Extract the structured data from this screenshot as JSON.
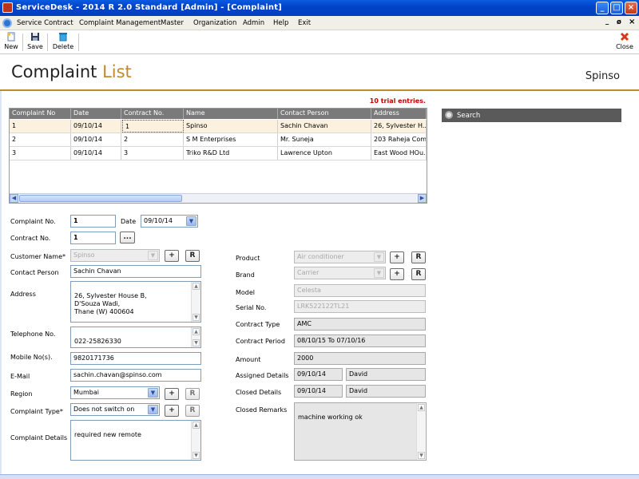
{
  "window": {
    "title": "ServiceDesk - 2014 R 2.0 Standard [Admin] - [Complaint]"
  },
  "menu": [
    "Service Contract",
    "Complaint Management",
    "Master",
    "Organization",
    "Admin",
    "Help",
    "Exit"
  ],
  "mdi_controls": {
    "minimize": "_",
    "restore": "ø",
    "close": "×"
  },
  "toolbar": {
    "new_label": "New",
    "save_label": "Save",
    "delete_label": "Delete",
    "close_label": "Close"
  },
  "header": {
    "title_main": "Complaint",
    "title_sub": "List",
    "org": "Spinso"
  },
  "trial_text": "10 trial entries.",
  "grid": {
    "columns": [
      "Complaint No",
      "Date",
      "Contract No.",
      "Name",
      "Contact Person",
      "Address"
    ],
    "rows": [
      [
        "1",
        "09/10/14",
        "1",
        "Spinso",
        "Sachin Chavan",
        "26, Sylvester H..."
      ],
      [
        "2",
        "09/10/14",
        "2",
        "S M Enterprises",
        "Mr. Suneja",
        "203 Raheja Com..."
      ],
      [
        "3",
        "09/10/14",
        "3",
        "Triko R&D Ltd",
        "Lawrence Upton",
        "East Wood HOu..."
      ]
    ],
    "selected_row": 0
  },
  "search": {
    "label": "Search"
  },
  "form": {
    "complaint_no_label": "Complaint No.",
    "complaint_no": "1",
    "date_label": "Date",
    "date": "09/10/14",
    "contract_no_label": "Contract No.",
    "contract_no": "1",
    "contract_btn": "...",
    "customer_name_label": "Customer Name*",
    "customer_name": "Spinso",
    "contact_person_label": "Contact Person",
    "contact_person": "Sachin Chavan",
    "address_label": "Address",
    "address": "26, Sylvester House B,\nD'Souza Wadi,\nThane (W) 400604",
    "telephone_label": "Telephone No.",
    "telephone": "022-25826330",
    "mobile_label": "Mobile No(s).",
    "mobile": "9820171736",
    "email_label": "E-Mail",
    "email": "sachin.chavan@spinso.com",
    "region_label": "Region",
    "region": "Mumbai",
    "complaint_type_label": "Complaint Type*",
    "complaint_type": "Does not switch on",
    "complaint_details_label": "Complaint Details",
    "complaint_details": "required new remote",
    "product_label": "Product",
    "product": "Air conditioner",
    "brand_label": "Brand",
    "brand": "Carrier",
    "model_label": "Model",
    "model": "Celesta",
    "serial_label": "Serial No.",
    "serial": "LRK522122TL21",
    "contract_type_label": "Contract Type",
    "contract_type": "AMC",
    "contract_period_label": "Contract Period",
    "contract_period": "08/10/15 To 07/10/16",
    "amount_label": "Amount",
    "amount": "2000",
    "assigned_label": "Assigned Details",
    "assigned_date": "09/10/14",
    "assigned_to": "David",
    "closed_label": "Closed Details",
    "closed_date": "09/10/14",
    "closed_by": "David",
    "closed_remarks_label": "Closed Remarks",
    "closed_remarks": "machine working ok",
    "plus": "+",
    "r": "R"
  }
}
